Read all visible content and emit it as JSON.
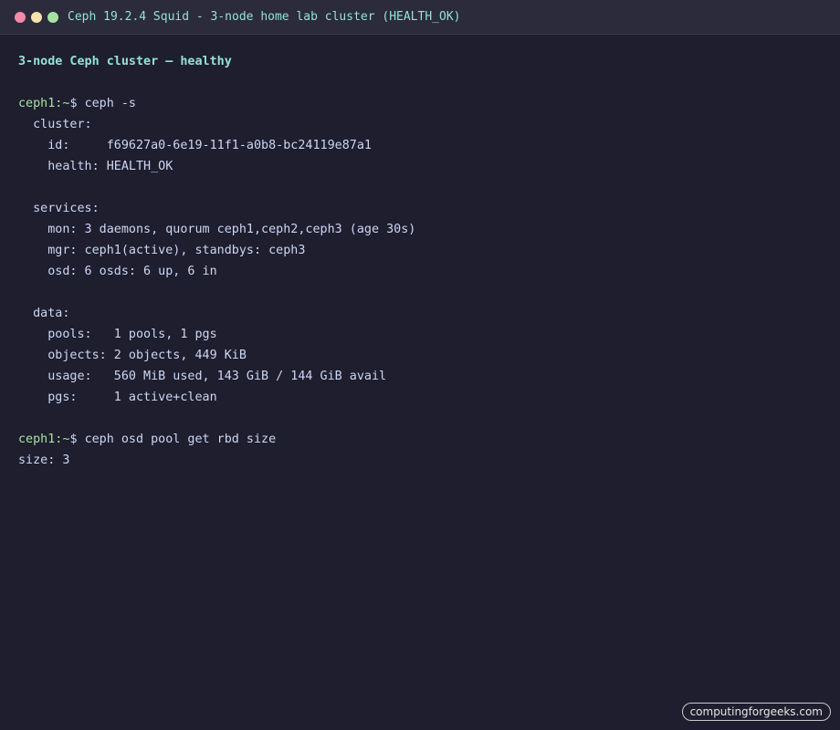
{
  "window": {
    "title": "Ceph 19.2.4 Squid - 3-node home lab cluster (HEALTH_OK)",
    "dot_colors": [
      "#f38ba8",
      "#f9e2af",
      "#a6e3a1"
    ]
  },
  "terminal": {
    "heading": "3-node Ceph cluster — healthy",
    "prompt_host": "ceph1:",
    "prompt_path": "~",
    "prompt_symbol": "$",
    "command1": "ceph -s",
    "output1": [
      "  cluster:",
      "    id:     f69627a0-6e19-11f1-a0b8-bc24119e87a1",
      "    health: HEALTH_OK",
      "",
      "  services:",
      "    mon: 3 daemons, quorum ceph1,ceph2,ceph3 (age 30s)",
      "    mgr: ceph1(active), standbys: ceph3",
      "    osd: 6 osds: 6 up, 6 in",
      "",
      "  data:",
      "    pools:   1 pools, 1 pgs",
      "    objects: 2 objects, 449 KiB",
      "    usage:   560 MiB used, 143 GiB / 144 GiB avail",
      "    pgs:     1 active+clean",
      ""
    ],
    "command2": "ceph osd pool get rbd size",
    "output2": [
      "size: 3"
    ]
  },
  "watermark": "computingforgeeks.com",
  "colors": {
    "background": "#1e1e2e",
    "titlebar": "#2b2b3c",
    "accent": "#94e2d5",
    "prompt": "#a6e3a1",
    "text": "#cdd6f4"
  }
}
